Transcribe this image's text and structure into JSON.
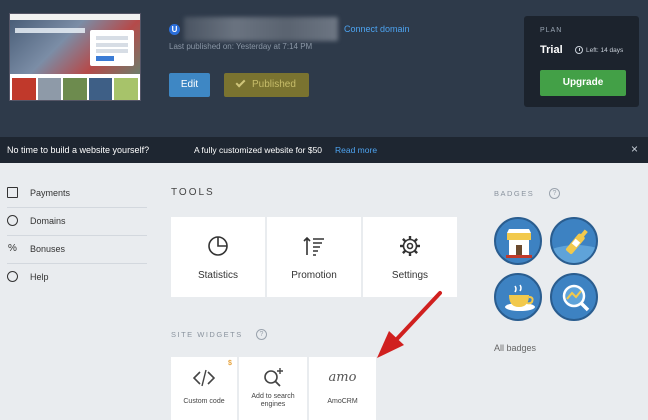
{
  "header": {
    "site_badge": "U",
    "connect_domain": "Connect domain",
    "last_published": "Last published on: Yesterday at 7:14 PM",
    "edit_label": "Edit",
    "published_label": "Published",
    "thumbnail_title": "Bookstore"
  },
  "plan": {
    "title": "PLAN",
    "name": "Trial",
    "left": "Left: 14 days",
    "upgrade_label": "Upgrade"
  },
  "promo": {
    "text_a": "No time to build a website yourself?",
    "text_b": "A fully customized website for $50",
    "link": "Read more",
    "close": "×"
  },
  "sidebar": {
    "items": [
      {
        "label": "Payments",
        "icon": "payments-icon"
      },
      {
        "label": "Domains",
        "icon": "domains-icon"
      },
      {
        "label": "Bonuses",
        "icon": "percent-icon"
      },
      {
        "label": "Help",
        "icon": "help-icon"
      }
    ]
  },
  "tools": {
    "title": "TOOLS",
    "items": [
      {
        "label": "Statistics",
        "icon": "pie-chart-icon"
      },
      {
        "label": "Promotion",
        "icon": "sort-icon"
      },
      {
        "label": "Settings",
        "icon": "gear-icon"
      }
    ]
  },
  "widgets": {
    "title": "SITE WIDGETS",
    "items": [
      {
        "label": "Custom code",
        "icon": "code-icon",
        "price_marker": "$"
      },
      {
        "label_line1": "Add to search",
        "label_line2": "engines",
        "icon": "search-plus-icon"
      },
      {
        "label": "AmoCRM",
        "logo": "amo"
      }
    ]
  },
  "badges": {
    "title": "BADGES",
    "all_label": "All badges",
    "colors": {
      "fill": "#3d82c2",
      "ring": "#2a5d8f"
    }
  },
  "colors": {
    "header_bg": "#2e3a4a",
    "accent_blue": "#3e87c4",
    "upgrade_green": "#43a047",
    "arrow_red": "#d0201f"
  }
}
